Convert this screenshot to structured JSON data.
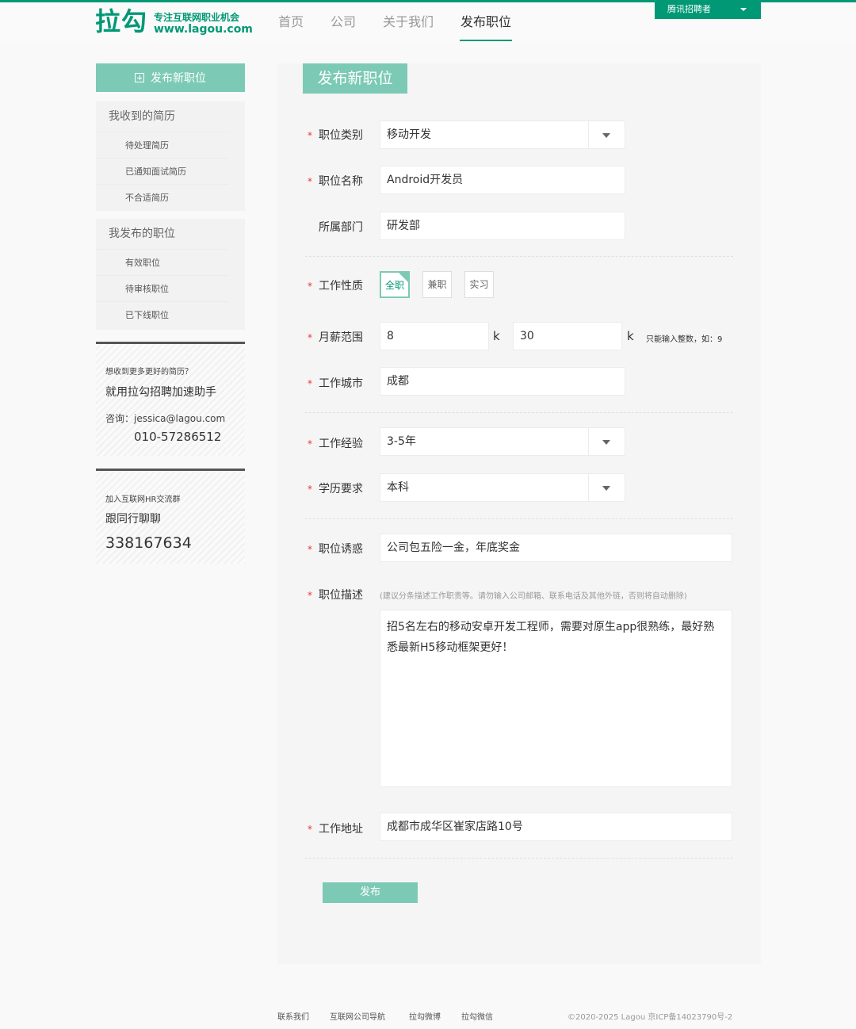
{
  "header": {
    "logo_mark": "拉勾",
    "logo_slogan": "专注互联网职业机会",
    "logo_url": "www.lagou.com",
    "nav": [
      {
        "label": "首页"
      },
      {
        "label": "公司"
      },
      {
        "label": "关于我们"
      },
      {
        "label": "发布职位"
      }
    ],
    "user_label": "腾讯招聘者"
  },
  "sidebar": {
    "post_button": "发布新职位",
    "groups": [
      {
        "title": "我收到的简历",
        "items": [
          "待处理简历",
          "已通知面试简历",
          "不合适简历"
        ]
      },
      {
        "title": "我发布的职位",
        "items": [
          "有效职位",
          "待审核职位",
          "已下线职位"
        ]
      }
    ],
    "promo1": {
      "line1": "想收到更多更好的简历？",
      "line2": "就用拉勾招聘加速助手",
      "line3": "咨询：jessica@lagou.com",
      "phone": "010-57286512"
    },
    "promo2": {
      "line1": "加入互联网HR交流群",
      "line2": "跟同行聊聊",
      "qq": "338167634"
    }
  },
  "form": {
    "title": "发布新职位",
    "job_category": {
      "label": "职位类别",
      "value": "移动开发"
    },
    "job_name": {
      "label": "职位名称",
      "value": "Android开发员"
    },
    "department": {
      "label": "所属部门",
      "value": "研发部"
    },
    "job_type": {
      "label": "工作性质",
      "options": [
        "全职",
        "兼职",
        "实习"
      ],
      "selected": "全职"
    },
    "salary": {
      "label": "月薪范围",
      "min": "8",
      "max": "30",
      "unit": "k",
      "hint": "只能输入整数，如：9"
    },
    "city": {
      "label": "工作城市",
      "value": "成都"
    },
    "experience": {
      "label": "工作经验",
      "value": "3-5年"
    },
    "education": {
      "label": "学历要求",
      "value": "本科"
    },
    "benefits": {
      "label": "职位诱惑",
      "value": "公司包五险一金，年底奖金"
    },
    "description": {
      "label": "职位描述",
      "hint": "(建议分条描述工作职责等。请勿输入公司邮箱、联系电话及其他外链，否则将自动删除)",
      "value": "招5名左右的移动安卓开发工程师，需要对原生app很熟练，最好熟悉最新H5移动框架更好！"
    },
    "address": {
      "label": "工作地址",
      "value": "成都市成华区崔家店路10号"
    },
    "submit": "发布"
  },
  "footer": {
    "links": [
      "联系我们",
      "互联网公司导航",
      "拉勾微博",
      "拉勾微信"
    ],
    "copyright": "©2020-2025 Lagou   京ICP备14023790号-2"
  },
  "colors": {
    "brand": "#019875",
    "accent_light": "#7ccab5",
    "required": "#e33"
  }
}
